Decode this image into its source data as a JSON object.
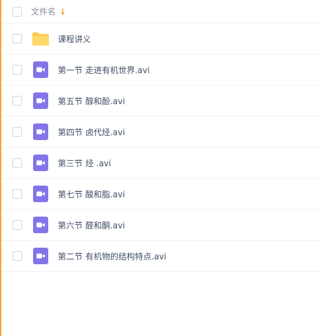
{
  "header": {
    "column_label": "文件名",
    "sort_icon": "arrow-down-icon"
  },
  "files": [
    {
      "name": "课程讲义",
      "type": "folder",
      "icon": "folder-icon"
    },
    {
      "name": "第一节 走进有机世界.avi",
      "type": "video",
      "icon": "video-file-icon"
    },
    {
      "name": "第五节 醇和酚.avi",
      "type": "video",
      "icon": "video-file-icon"
    },
    {
      "name": "第四节 卤代烃.avi",
      "type": "video",
      "icon": "video-file-icon"
    },
    {
      "name": "第三节 烃 .avi",
      "type": "video",
      "icon": "video-file-icon"
    },
    {
      "name": "第七节 酸和脂.avi",
      "type": "video",
      "icon": "video-file-icon"
    },
    {
      "name": "第六节 醛和酮.avi",
      "type": "video",
      "icon": "video-file-icon"
    },
    {
      "name": "第二节 有机物的结构特点.avi",
      "type": "video",
      "icon": "video-file-icon"
    }
  ],
  "colors": {
    "accent": "#f49a3a",
    "folder": "#ffc94c",
    "video": "#8375e9"
  }
}
